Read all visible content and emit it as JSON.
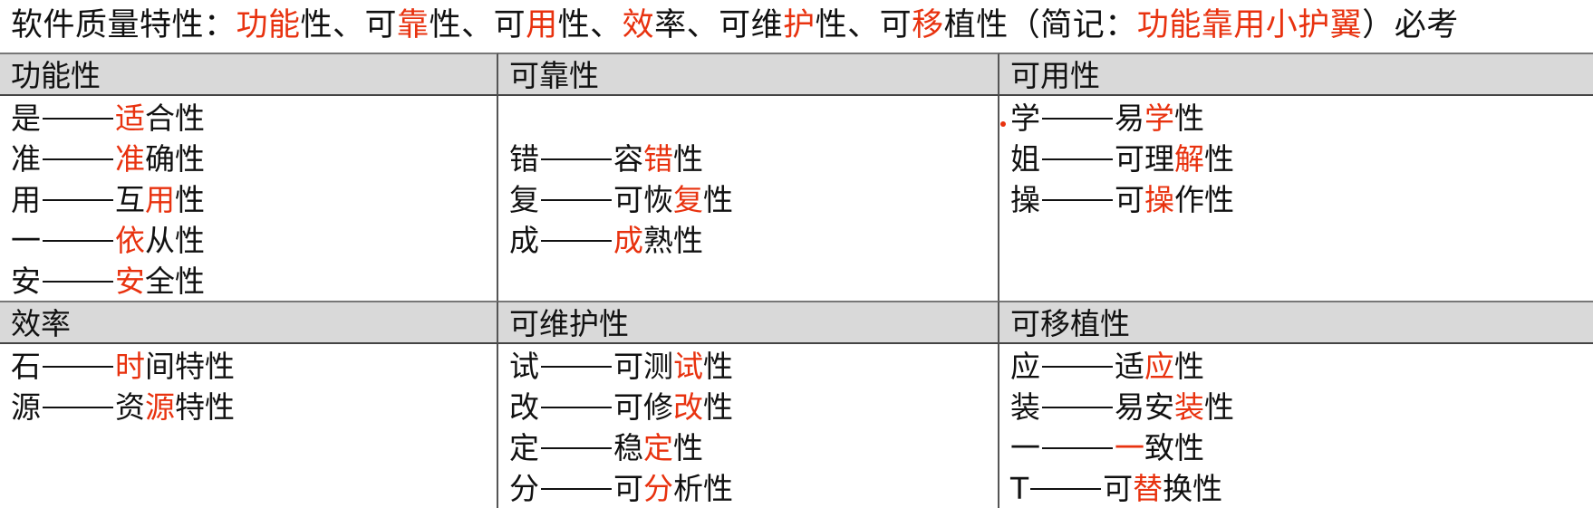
{
  "title": {
    "prefix": "软件质量特性：",
    "parts": [
      {
        "text": "功能",
        "hl": true
      },
      {
        "text": "性、可",
        "hl": false
      },
      {
        "text": "靠",
        "hl": true
      },
      {
        "text": "性、可",
        "hl": false
      },
      {
        "text": "用",
        "hl": true
      },
      {
        "text": "性、",
        "hl": false
      },
      {
        "text": "效",
        "hl": true
      },
      {
        "text": "率、可维",
        "hl": false
      },
      {
        "text": "护",
        "hl": true
      },
      {
        "text": "性、可",
        "hl": false
      },
      {
        "text": "移",
        "hl": true
      },
      {
        "text": "植性（简记：",
        "hl": false
      },
      {
        "text": "功能靠用小护翼",
        "hl": true
      },
      {
        "text": "）必考",
        "hl": false
      }
    ]
  },
  "colors": {
    "highlight": "#e8320f",
    "header_bg": "#d9d9d9"
  },
  "sections": [
    {
      "header": "功能性",
      "items": [
        {
          "key": "是",
          "pre": "",
          "hl": "适",
          "post": "合性"
        },
        {
          "key": "准",
          "pre": "",
          "hl": "准",
          "post": "确性"
        },
        {
          "key": "用",
          "pre": "互",
          "hl": "用",
          "post": "性"
        },
        {
          "key": "一",
          "pre": "",
          "hl": "依",
          "post": "从性"
        },
        {
          "key": "安",
          "pre": "",
          "hl": "安",
          "post": "全性"
        }
      ]
    },
    {
      "header": "可靠性",
      "leading_blank": true,
      "items": [
        {
          "key": "错",
          "pre": "容",
          "hl": "错",
          "post": "性"
        },
        {
          "key": "复",
          "pre": "可恢",
          "hl": "复",
          "post": "性"
        },
        {
          "key": "成",
          "pre": "",
          "hl": "成",
          "post": "熟性"
        }
      ]
    },
    {
      "header": "可用性",
      "items": [
        {
          "key": "学",
          "pre": "易",
          "hl": "学",
          "post": "性"
        },
        {
          "key": "姐",
          "pre": "可理",
          "hl": "解",
          "post": "性"
        },
        {
          "key": "操",
          "pre": "可",
          "hl": "操",
          "post": "作性"
        }
      ]
    },
    {
      "header": "效率",
      "items": [
        {
          "key": "石",
          "pre": "",
          "hl": "时",
          "post": "间特性"
        },
        {
          "key": "源",
          "pre": "资",
          "hl": "源",
          "post": "特性"
        }
      ]
    },
    {
      "header": "可维护性",
      "items": [
        {
          "key": "试",
          "pre": "可测",
          "hl": "试",
          "post": "性"
        },
        {
          "key": "改",
          "pre": "可修",
          "hl": "改",
          "post": "性"
        },
        {
          "key": "定",
          "pre": "稳",
          "hl": "定",
          "post": "性"
        },
        {
          "key": "分",
          "pre": "可",
          "hl": "分",
          "post": "析性"
        }
      ]
    },
    {
      "header": "可移植性",
      "items": [
        {
          "key": "应",
          "pre": "适",
          "hl": "应",
          "post": "性"
        },
        {
          "key": "装",
          "pre": "易安",
          "hl": "装",
          "post": "性"
        },
        {
          "key": "一",
          "pre": "",
          "hl": "一",
          "post": "致性"
        },
        {
          "key": "T",
          "pre": "可",
          "hl": "替",
          "post": "换性"
        }
      ]
    }
  ]
}
